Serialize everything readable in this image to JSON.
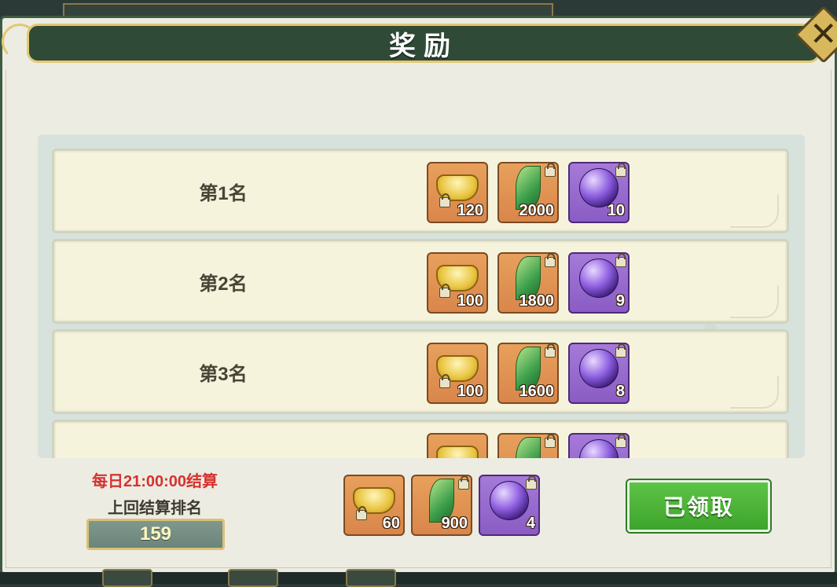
{
  "header": {
    "title": "奖励",
    "close_icon": "close-icon"
  },
  "rank_rows": [
    {
      "rank": "第1名",
      "rewards": [
        {
          "icon": "gold-ingot-icon",
          "color": "orange",
          "qty": "120"
        },
        {
          "icon": "green-leaf-icon",
          "color": "orange",
          "qty": "2000"
        },
        {
          "icon": "purple-orb-icon",
          "color": "purple",
          "qty": "10"
        }
      ]
    },
    {
      "rank": "第2名",
      "rewards": [
        {
          "icon": "gold-ingot-icon",
          "color": "orange",
          "qty": "100"
        },
        {
          "icon": "green-leaf-icon",
          "color": "orange",
          "qty": "1800"
        },
        {
          "icon": "purple-orb-icon",
          "color": "purple",
          "qty": "9"
        }
      ]
    },
    {
      "rank": "第3名",
      "rewards": [
        {
          "icon": "gold-ingot-icon",
          "color": "orange",
          "qty": "100"
        },
        {
          "icon": "green-leaf-icon",
          "color": "orange",
          "qty": "1600"
        },
        {
          "icon": "purple-orb-icon",
          "color": "purple",
          "qty": "8"
        }
      ]
    },
    {
      "rank": "",
      "rewards": [
        {
          "icon": "gold-ingot-icon",
          "color": "orange",
          "qty": ""
        },
        {
          "icon": "green-leaf-icon",
          "color": "orange",
          "qty": ""
        },
        {
          "icon": "purple-orb-icon",
          "color": "purple",
          "qty": ""
        }
      ]
    }
  ],
  "footer": {
    "settle_time": "每日21:00:00结算",
    "last_rank_label": "上回结算排名",
    "last_rank_value": "159",
    "my_rewards": [
      {
        "icon": "gold-ingot-icon",
        "color": "orange",
        "qty": "60"
      },
      {
        "icon": "green-leaf-icon",
        "color": "orange",
        "qty": "900"
      },
      {
        "icon": "purple-orb-icon",
        "color": "purple",
        "qty": "4"
      }
    ],
    "claimed_label": "已领取"
  },
  "colors": {
    "title_bar": "#2f4a36",
    "gold_trim": "#e3c873",
    "claim_green": "#4cb336",
    "settle_red": "#d6322e"
  }
}
